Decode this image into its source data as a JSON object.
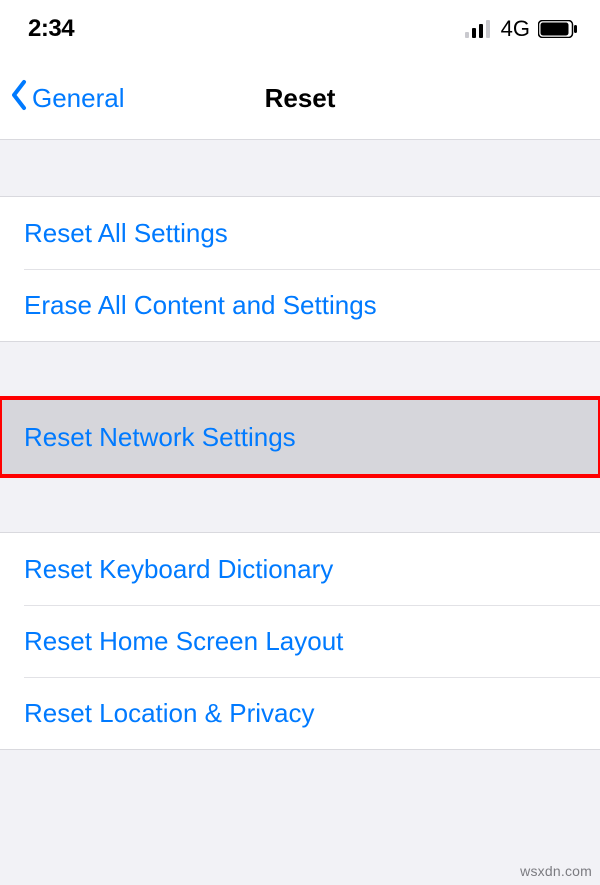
{
  "status_bar": {
    "time": "2:34",
    "network_label": "4G"
  },
  "nav": {
    "back_label": "General",
    "title": "Reset"
  },
  "sections": {
    "group1": {
      "reset_all": "Reset All Settings",
      "erase_all": "Erase All Content and Settings"
    },
    "group2": {
      "reset_network": "Reset Network Settings"
    },
    "group3": {
      "reset_keyboard": "Reset Keyboard Dictionary",
      "reset_home": "Reset Home Screen Layout",
      "reset_location": "Reset Location & Privacy"
    }
  },
  "watermark": "wsxdn.com"
}
